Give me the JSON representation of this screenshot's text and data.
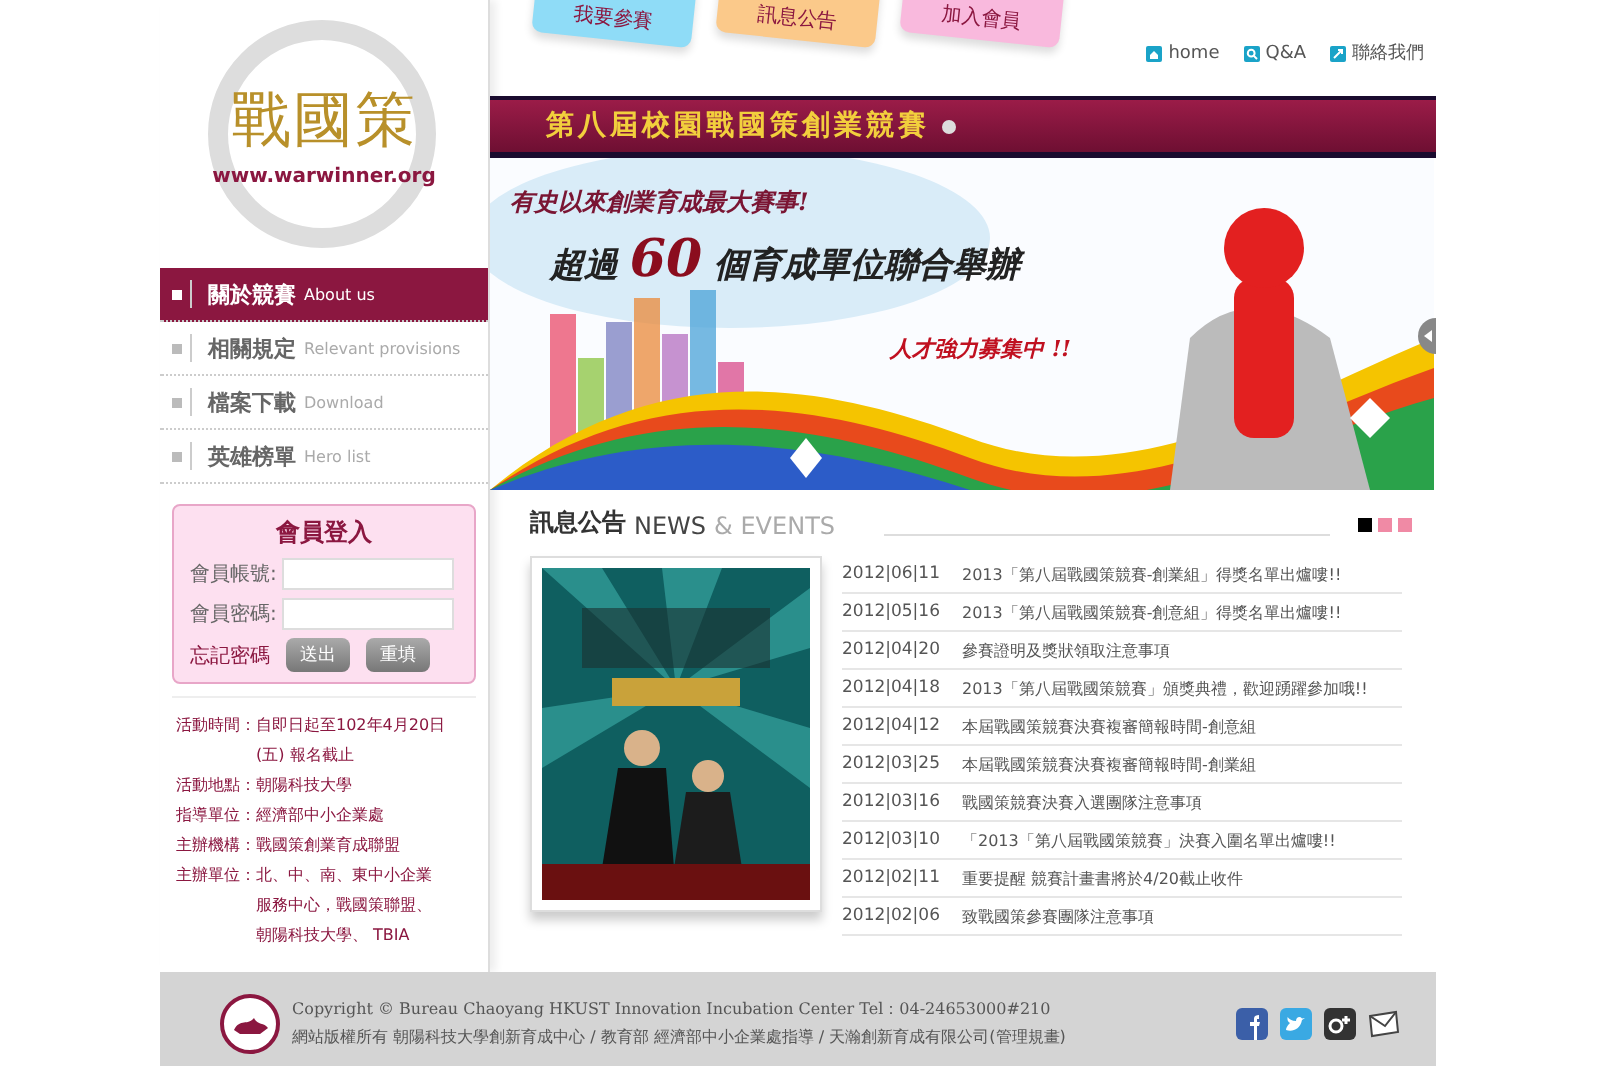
{
  "logo": {
    "name": "戰國策",
    "url": "www.warwinner.org"
  },
  "top_tabs": [
    {
      "label": "我要參賽",
      "color": "#8fdcf7"
    },
    {
      "label": "訊息公告",
      "color": "#fbc98a"
    },
    {
      "label": "加入會員",
      "color": "#f9b9dd"
    }
  ],
  "top_links": [
    {
      "label": "home",
      "kind": "home"
    },
    {
      "label": "Q&A",
      "kind": "search"
    },
    {
      "label": "聯絡我們",
      "kind": "mail"
    }
  ],
  "title_bar": "第八屆校園戰國策創業競賽",
  "banner": {
    "line1": "有史以來創業育成最大賽事!",
    "line2_before": "超過",
    "line2_number": "60",
    "line2_after": "個育成單位聯合舉辦",
    "line3": "人才強力募集中 !!"
  },
  "nav": [
    {
      "label": "關於競賽",
      "english": "About us",
      "selected": true
    },
    {
      "label": "相關規定",
      "english": "Relevant provisions",
      "selected": false
    },
    {
      "label": "檔案下載",
      "english": "Download",
      "selected": false
    },
    {
      "label": "英雄榜單",
      "english": "Hero list",
      "selected": false
    }
  ],
  "login": {
    "title": "會員登入",
    "fields": [
      {
        "label": "會員帳號:"
      },
      {
        "label": "會員密碼:"
      }
    ],
    "forgot": "忘記密碼",
    "buttons": [
      "送出",
      "重填"
    ]
  },
  "info": [
    {
      "label": "活動時間：",
      "lines": [
        "自即日起至102年4月20日",
        "(五) 報名截止"
      ]
    },
    {
      "label": "活動地點：",
      "lines": [
        "朝陽科技大學"
      ]
    },
    {
      "label": "指導單位：",
      "lines": [
        "經濟部中小企業處"
      ]
    },
    {
      "label": "主辦機構：",
      "lines": [
        "戰國策創業育成聯盟"
      ]
    },
    {
      "label": "主辦單位：",
      "lines": [
        "北、中、南、東中小企業",
        "服務中心，戰國策聯盟、",
        "朝陽科技大學、 TBIA"
      ]
    }
  ],
  "news": {
    "title": "訊息公告",
    "title_en": "NEWS",
    "title_en2": "& EVENTS",
    "pages": [
      {
        "selected": true
      },
      {
        "selected": false
      },
      {
        "selected": false
      }
    ],
    "items": [
      {
        "date": "2012|06|11",
        "text": "2013「第八屆戰國策競賽-創業組」得獎名單出爐嘍!!"
      },
      {
        "date": "2012|05|16",
        "text": "2013「第八屆戰國策競賽-創意組」得獎名單出爐嘍!!"
      },
      {
        "date": "2012|04|20",
        "text": "參賽證明及獎狀領取注意事項"
      },
      {
        "date": "2012|04|18",
        "text": "2013「第八屆戰國策競賽」頒獎典禮，歡迎踴躍參加哦!!"
      },
      {
        "date": "2012|04|12",
        "text": "本屆戰國策競賽決賽複審簡報時間-創意組"
      },
      {
        "date": "2012|03|25",
        "text": "本屆戰國策競賽決賽複審簡報時間-創業組"
      },
      {
        "date": "2012|03|16",
        "text": "戰國策競賽決賽入選團隊注意事項"
      },
      {
        "date": "2012|03|10",
        "text": "「2013「第八屆戰國策競賽」決賽入圍名單出爐嘍!!"
      },
      {
        "date": "2012|02|11",
        "text": "重要提醒 競賽計畫書將於4/20截止收件"
      },
      {
        "date": "2012|02|06",
        "text": "致戰國策參賽團隊注意事項"
      }
    ]
  },
  "footer": {
    "copyright": "Copyright ©  Bureau Chaoyang HKUST Innovation Incubation Center   Tel：04-24653000#210",
    "credits": "網站版權所有  朝陽科技大學創新育成中心  /  教育部  經濟部中小企業處指導  /  天瀚創新育成有限公司(管理規畫)",
    "social": [
      {
        "kind": "facebook"
      },
      {
        "kind": "twitter"
      },
      {
        "kind": "google"
      },
      {
        "kind": "mail"
      }
    ]
  }
}
